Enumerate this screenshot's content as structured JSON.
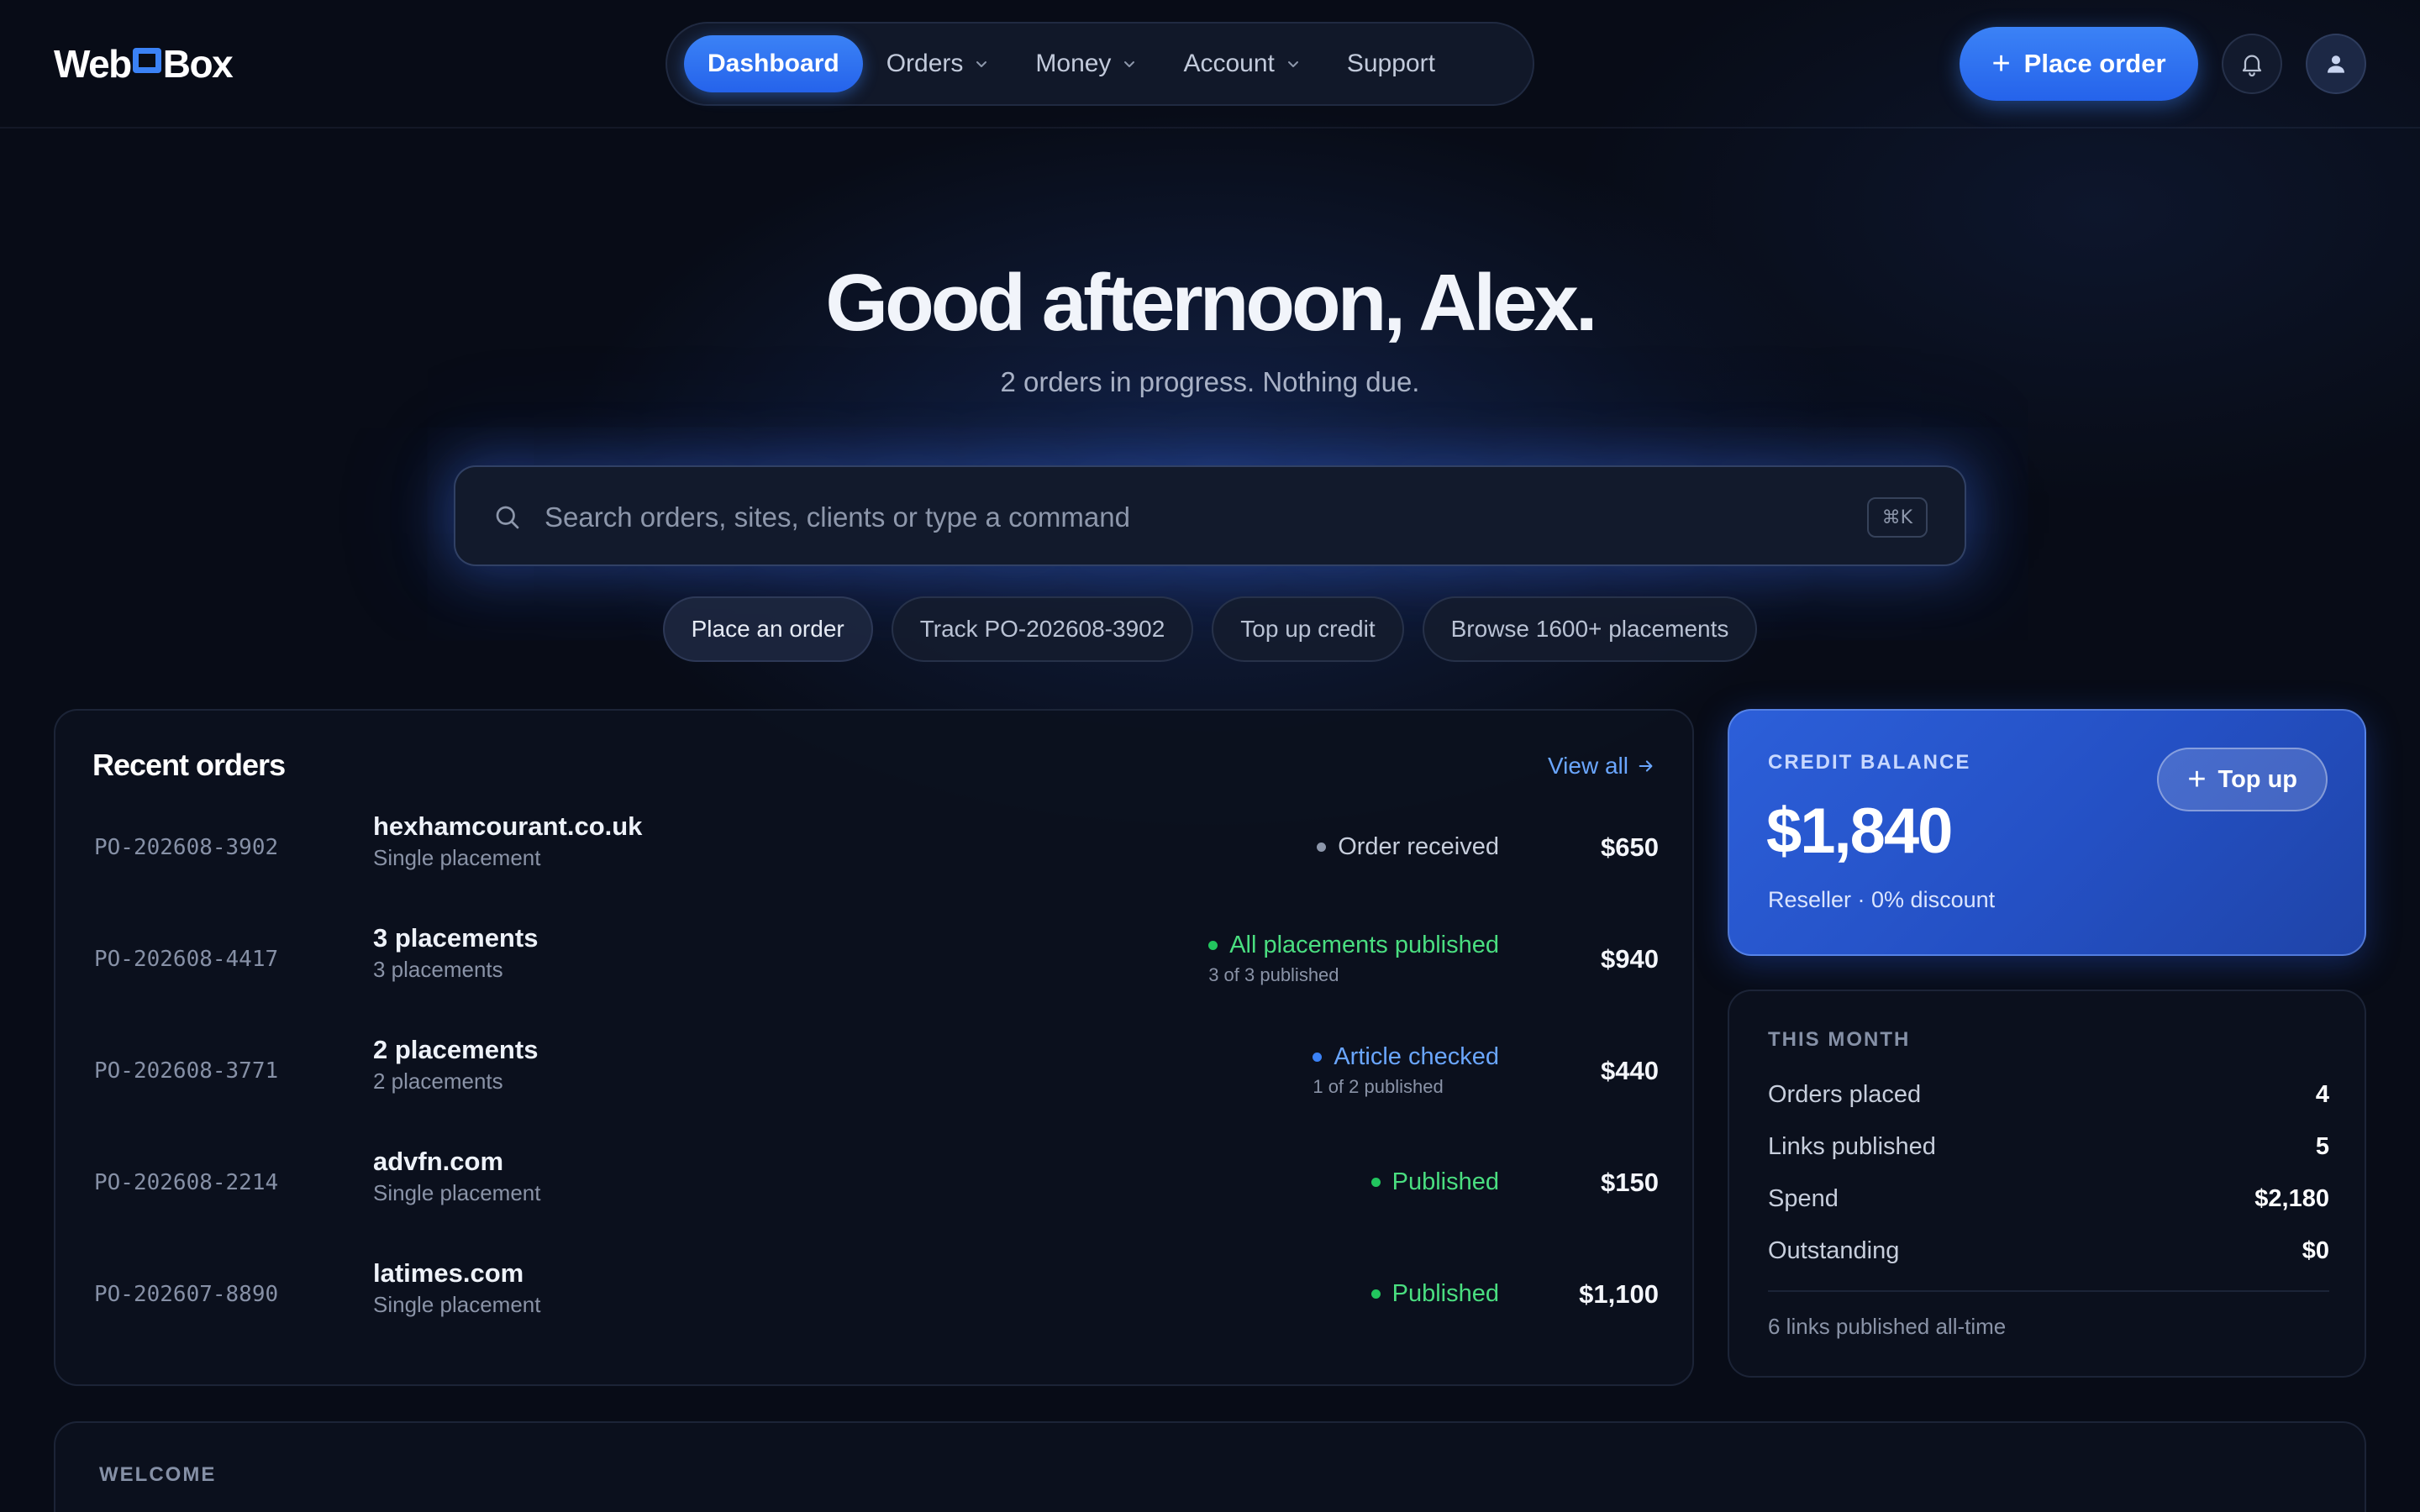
{
  "brand": {
    "name_left": "Web",
    "name_right": "Box",
    "accent": "#3b82f6"
  },
  "nav": {
    "items": [
      {
        "label": "Dashboard",
        "active": true,
        "dropdown": false
      },
      {
        "label": "Orders",
        "active": false,
        "dropdown": true
      },
      {
        "label": "Money",
        "active": false,
        "dropdown": true
      },
      {
        "label": "Account",
        "active": false,
        "dropdown": true
      },
      {
        "label": "Support",
        "active": false,
        "dropdown": false
      }
    ],
    "place_order_label": "Place order",
    "icons": [
      "plus-icon",
      "bell-icon",
      "user-icon",
      "chevron-down-icon"
    ]
  },
  "hero": {
    "greeting": "Good afternoon, Alex.",
    "subtitle": "2 orders in progress. Nothing due."
  },
  "search": {
    "placeholder": "Search orders, sites, clients or type a command",
    "shortcut": "⌘K"
  },
  "quick_actions": [
    "Place an order",
    "Track PO-202608-3902",
    "Top up credit",
    "Browse 1600+ placements"
  ],
  "recent_orders": {
    "title": "Recent orders",
    "view_all_label": "View all",
    "rows": [
      {
        "po": "PO-202608-3902",
        "site": "hexhamcourant.co.uk",
        "detail": "Single placement",
        "status": "Order received",
        "status_sub": "",
        "status_color": "#c7cedc",
        "dot_color": "#8d97ab",
        "amount": "$650"
      },
      {
        "po": "PO-202608-4417",
        "site": "3 placements",
        "detail": "3 placements",
        "status": "All placements published",
        "status_sub": "3 of 3 published",
        "status_color": "#4ade80",
        "dot_color": "#22c55e",
        "amount": "$940"
      },
      {
        "po": "PO-202608-3771",
        "site": "2 placements",
        "detail": "2 placements",
        "status": "Article checked",
        "status_sub": "1 of 2 published",
        "status_color": "#6aa6ff",
        "dot_color": "#3b82f6",
        "amount": "$440"
      },
      {
        "po": "PO-202608-2214",
        "site": "advfn.com",
        "detail": "Single placement",
        "status": "Published",
        "status_sub": "",
        "status_color": "#4ade80",
        "dot_color": "#22c55e",
        "amount": "$150"
      },
      {
        "po": "PO-202607-8890",
        "site": "latimes.com",
        "detail": "Single placement",
        "status": "Published",
        "status_sub": "",
        "status_color": "#4ade80",
        "dot_color": "#22c55e",
        "amount": "$1,100"
      }
    ]
  },
  "credit": {
    "label": "CREDIT BALANCE",
    "amount": "$1,840",
    "sub": "Reseller · 0% discount",
    "top_up_label": "Top up"
  },
  "this_month": {
    "label": "THIS MONTH",
    "stats": [
      {
        "label": "Orders placed",
        "value": "4"
      },
      {
        "label": "Links published",
        "value": "5"
      },
      {
        "label": "Spend",
        "value": "$2,180"
      },
      {
        "label": "Outstanding",
        "value": "$0"
      }
    ],
    "footer": "6 links published all-time"
  },
  "welcome": {
    "label": "WELCOME"
  }
}
